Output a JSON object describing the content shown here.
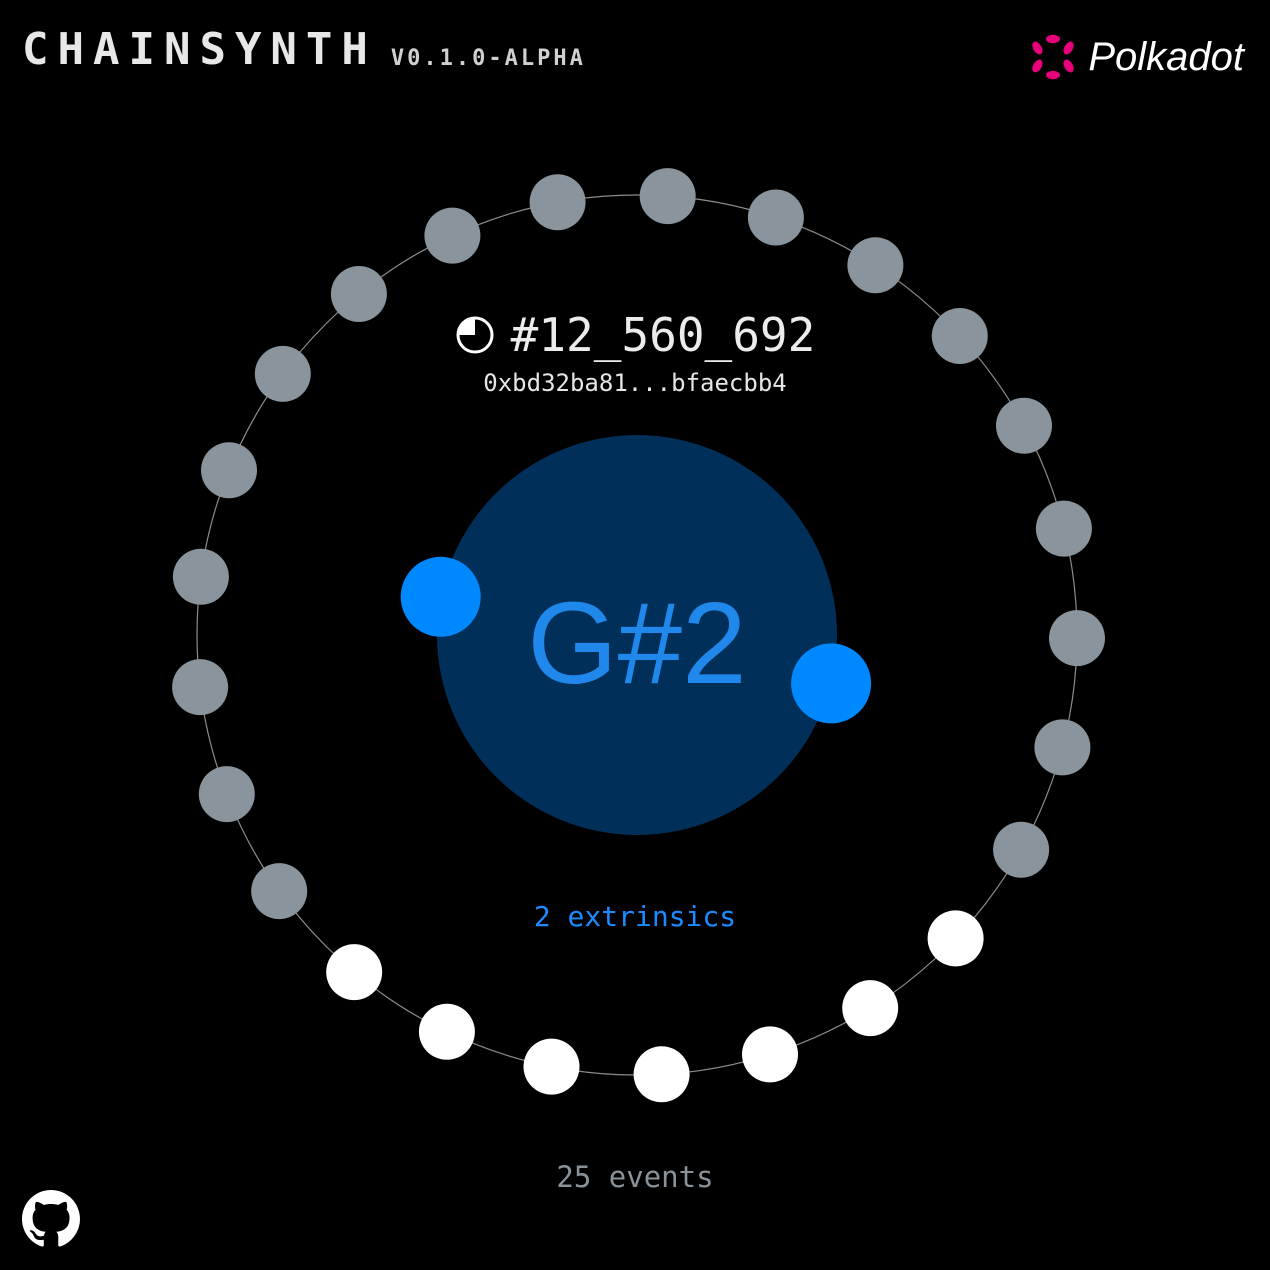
{
  "header": {
    "title": "CHAINSYNTH",
    "version": "V0.1.0-ALPHA",
    "network_name": "Polkadot"
  },
  "block": {
    "number": "#12_560_692",
    "hash": "0xbd32ba81...bfaecbb4",
    "progress": 0.75
  },
  "note": "G#2",
  "extrinsics": {
    "count": 2,
    "label": "2 extrinsics"
  },
  "events": {
    "count": 25,
    "active": 7,
    "label": "25 events"
  },
  "colors": {
    "background": "#000000",
    "accent_blue": "#0088ff",
    "note_disc": "#002f5a",
    "inactive_event": "#8a949c",
    "active_event": "#ffffff",
    "polkadot_pink": "#e6007a"
  },
  "icons": {
    "clock": "clock-icon",
    "polkadot": "polkadot-logo-icon",
    "github": "github-icon"
  }
}
